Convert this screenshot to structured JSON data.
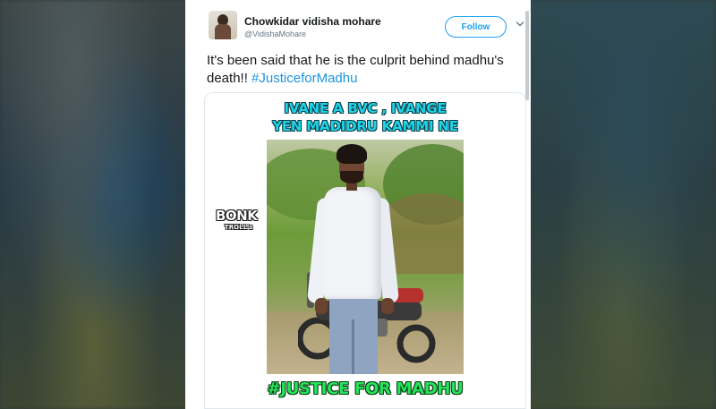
{
  "tweet": {
    "author_name": "Chowkidar vidisha mohare",
    "author_handle": "@VidishaMohare",
    "follow_label": "Follow",
    "text_plain": "It's been said that he is the culprit behind madhu's death!! ",
    "hashtag": "#JusticeforMadhu"
  },
  "media": {
    "caption_line1": "IVANE A BVC , IVANGE",
    "caption_line2": "YEN MADIDRU KAMMI NE",
    "watermark_main": "BONK",
    "watermark_sub": "TROLL's",
    "caption_bottom": "#JUSTICE FOR MADHU"
  },
  "colors": {
    "accent": "#1da1f2",
    "hashtag": "#1b95e0",
    "caption_top": "#1fd3e8",
    "caption_bottom": "#25e35a"
  },
  "icons": {
    "caret": "chevron-down-icon"
  }
}
